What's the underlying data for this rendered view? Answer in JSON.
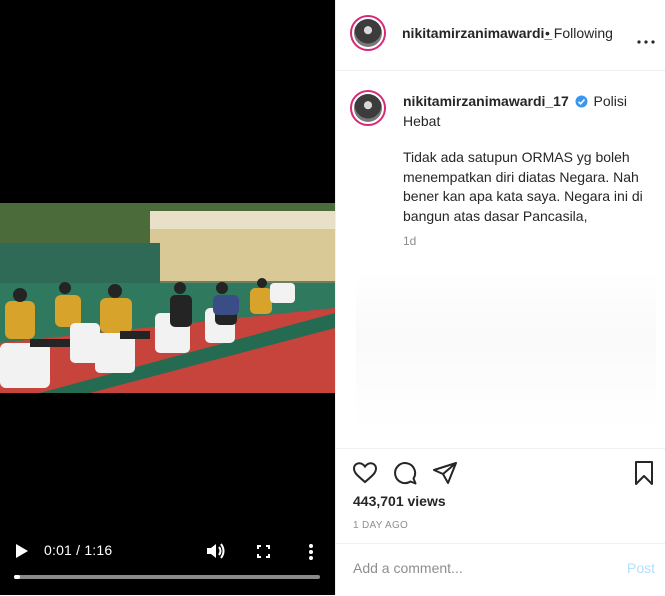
{
  "video": {
    "time": "0:01 / 1:16",
    "progress": 0.02
  },
  "post": {
    "header_username": "nikitamirzanimawardi_",
    "following_label": "Following",
    "caption_username": "nikitamirzanimawardi_17",
    "caption_first": "Polisi Hebat",
    "caption_body": "Tidak ada satupun ORMAS yg boleh menempatkan diri diatas Negara. Nah bener kan apa kata saya. Negara ini di bangun atas dasar Pancasila,",
    "age": "1d",
    "views": "443,701 views",
    "date": "1 DAY AGO",
    "comment_placeholder": "Add a comment...",
    "post_label": "Post"
  },
  "icons": {
    "verified": "verified-badge-icon",
    "like": "heart-icon",
    "comment": "comment-icon",
    "share": "share-icon",
    "save": "bookmark-icon",
    "more": "more-dots-icon",
    "play": "play-icon",
    "volume": "volume-icon",
    "fullscreen": "fullscreen-icon"
  },
  "colors": {
    "verified": "#3897f0",
    "post_disabled": "#b2dffc",
    "avatar_ring": "#d62976"
  }
}
